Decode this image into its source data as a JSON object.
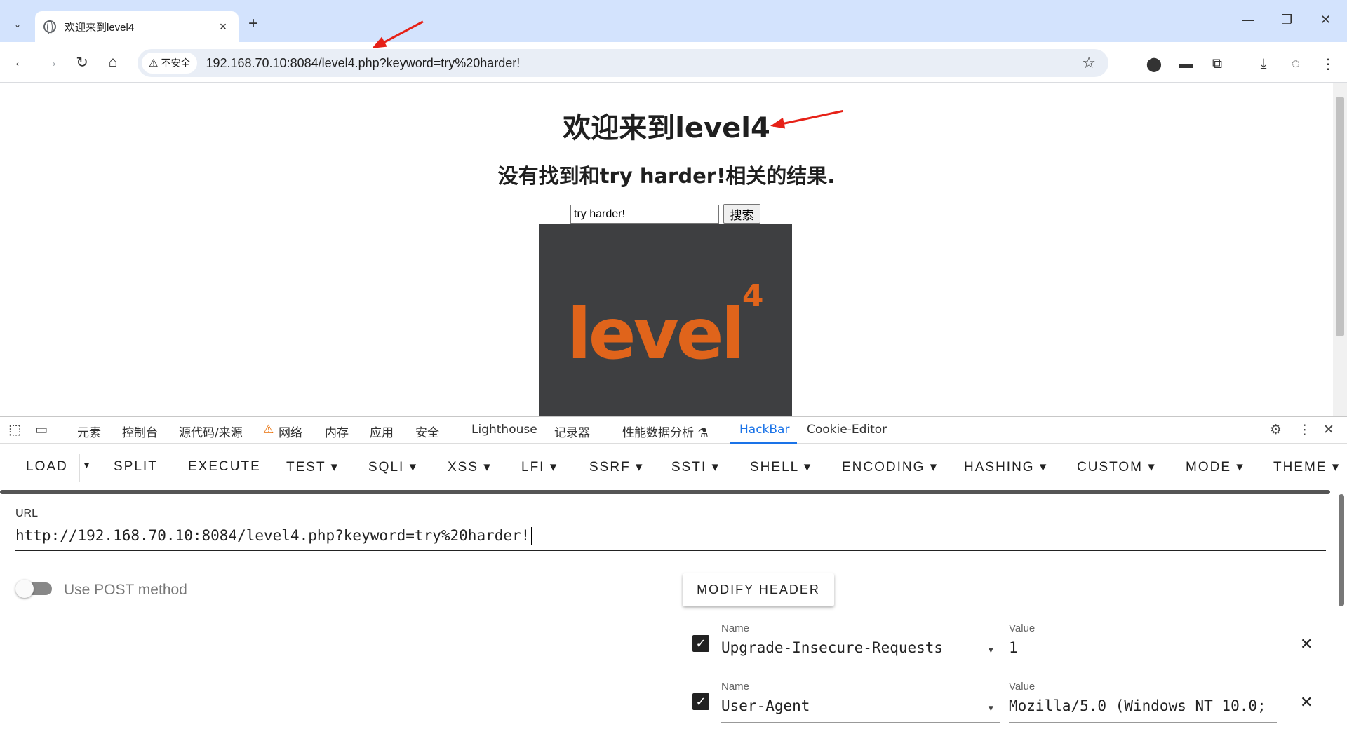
{
  "browser": {
    "tab_title": "欢迎来到level4",
    "tab_close": "×",
    "new_tab": "+",
    "security_label": "不安全",
    "url": "192.168.70.10:8084/level4.php?keyword=try%20harder!",
    "icons": [
      "back-icon",
      "forward-icon",
      "reload-icon",
      "home-icon",
      "star-icon",
      "extensions-icon",
      "download-icon",
      "menu-icon"
    ]
  },
  "page": {
    "heading": "欢迎来到level4",
    "result_text": "没有找到和try harder!相关的结果.",
    "search_value": "try harder!",
    "search_button": "搜索",
    "image_text": "level",
    "image_superscript": "4"
  },
  "devtools": {
    "tabs": [
      "元素",
      "控制台",
      "源代码/来源",
      "网络",
      "内存",
      "应用",
      "安全",
      "Lighthouse",
      "记录器",
      "性能数据分析 ⚗",
      "HackBar",
      "Cookie-Editor"
    ],
    "active_tab": "HackBar"
  },
  "hackbar": {
    "buttons": [
      "LOAD",
      "SPLIT",
      "EXECUTE",
      "TEST ▾",
      "SQLI ▾",
      "XSS ▾",
      "LFI ▾",
      "SSRF ▾",
      "SSTI ▾",
      "SHELL ▾",
      "ENCODING ▾",
      "HASHING ▾",
      "CUSTOM ▾",
      "MODE ▾",
      "THEME ▾"
    ],
    "load_dropdown": "▾",
    "url_label": "URL",
    "url_value": "http://192.168.70.10:8084/level4.php?keyword=try%20harder!",
    "post_label": "Use POST method",
    "modify_header": "MODIFY HEADER",
    "headers": [
      {
        "name_label": "Name",
        "value_label": "Value",
        "name": "Upgrade-Insecure-Requests",
        "value": "1",
        "checked": true
      },
      {
        "name_label": "Name",
        "value_label": "Value",
        "name": "User-Agent",
        "value": "Mozilla/5.0 (Windows NT 10.0;",
        "checked": true
      }
    ]
  },
  "colors": {
    "tabstrip": "#d3e3fd",
    "accent": "#1a73e8",
    "logo_orange": "#e0641b",
    "image_bg": "#3e3f41",
    "arrow_red": "#e62117"
  }
}
